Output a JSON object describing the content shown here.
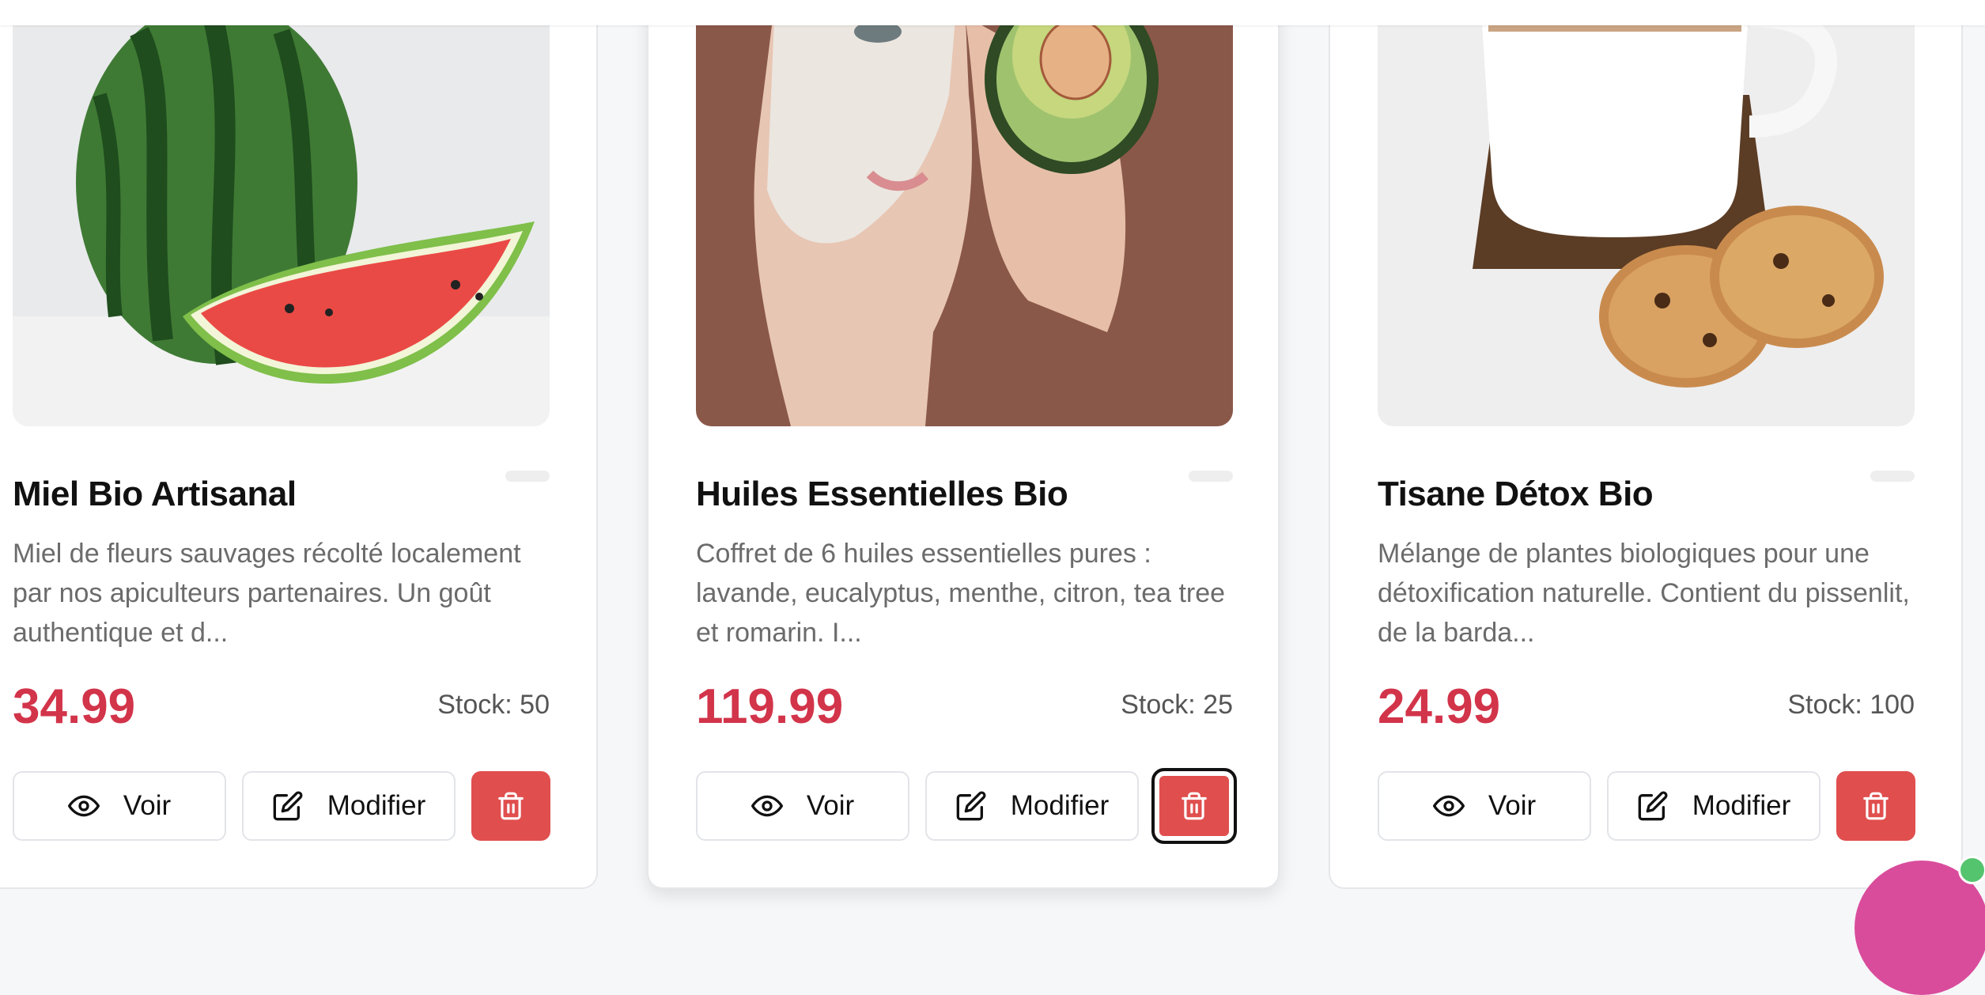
{
  "products": [
    {
      "title": "Miel Bio Artisanal",
      "description": "Miel de fleurs sauvages récolté localement par nos apiculteurs partenaires. Un goût authentique et d...",
      "price": "34.99",
      "stock": "Stock: 50",
      "image": "watermark-watermelon-photo"
    },
    {
      "title": "Huiles Essentielles Bio",
      "description": "Coffret de 6 huiles essentielles pures : lavande, eucalyptus, menthe, citron, tea tree et romarin. I...",
      "price": "119.99",
      "stock": "Stock: 25",
      "image": "face-mask-avocado-photo"
    },
    {
      "title": "Tisane Détox Bio",
      "description": "Mélange de plantes biologiques pour une détoxification naturelle. Contient du pissenlit, de la barda...",
      "price": "24.99",
      "stock": "Stock: 100",
      "image": "tea-cup-cookies-photo"
    }
  ],
  "actions": {
    "view_label": "Voir",
    "edit_label": "Modifier",
    "view_icon": "eye-icon",
    "edit_icon": "edit-icon",
    "delete_icon": "trash-icon"
  },
  "colors": {
    "price": "#d2344a",
    "delete_button": "#e04e4e",
    "fab": "#d94c9c",
    "status_dot": "#55c46f"
  }
}
